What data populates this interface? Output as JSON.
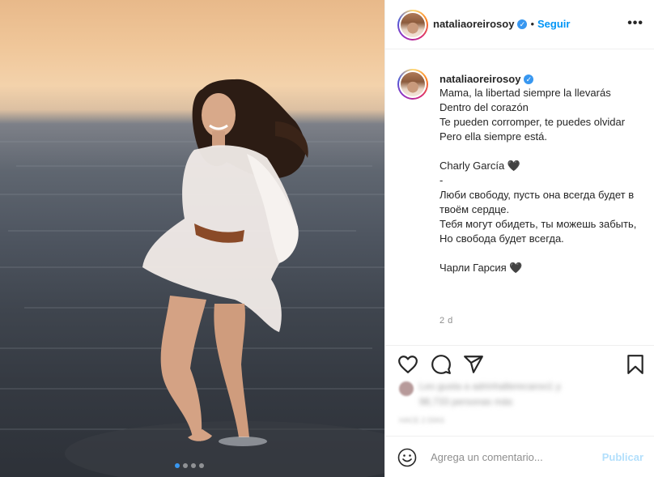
{
  "account": {
    "username": "nataliaoreirosoy",
    "verified_icon": "verified-badge-icon",
    "follow_label": "Seguir",
    "separator": "•",
    "more_icon": "more-options-icon"
  },
  "caption": {
    "lines": [
      "Mama, la libertad siempre la llevarás",
      "Dentro del corazón",
      "Te pueden corromper, te puedes olvidar",
      "Pero ella siempre está.",
      "",
      "Charly García 🖤",
      "-",
      "Люби свободу, пусть она всегда будет в твоём сердце.",
      "Тебя могут обидеть, ты можешь забыть,",
      "Но свобода будет всегда.",
      "",
      "Чарли Гарсия 🖤"
    ],
    "time": "2 d"
  },
  "actions": {
    "like_icon": "heart-icon",
    "comment_icon": "comment-bubble-icon",
    "share_icon": "paper-plane-icon",
    "save_icon": "bookmark-icon"
  },
  "likes": {
    "line1": "Les gusta a adrinhalterecaroo1 y",
    "line2": "98,733 personas más",
    "date": "HACE 2 DÍAS"
  },
  "comment_box": {
    "emoji_icon": "emoji-smile-icon",
    "placeholder": "Agrega un comentario...",
    "publish_label": "Publicar"
  },
  "carousel": {
    "slides": 4,
    "active_index": 0
  },
  "colors": {
    "accent": "#0095f6",
    "verified": "#3897f0",
    "publish_disabled": "#b2dffc",
    "border": "#efefef"
  }
}
